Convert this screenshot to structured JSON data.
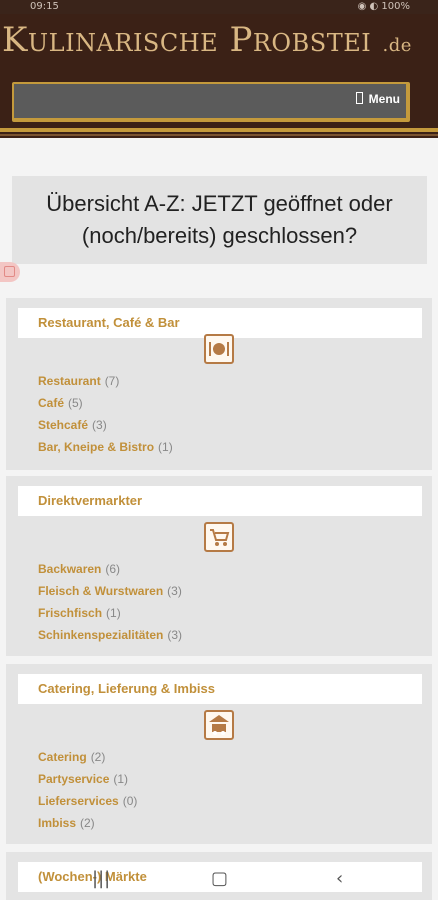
{
  "status": {
    "time": "09:15",
    "icons": "◉ ◐ 100%"
  },
  "site": {
    "logo_main": "Kulinarische Probstei",
    "logo_tld": ".de"
  },
  "nav": {
    "menu_label": "Menu"
  },
  "page": {
    "title": "Übersicht A-Z: JETZT geöffnet oder (noch/bereits) geschlossen?"
  },
  "categories": [
    {
      "title": "Restaurant, Café & Bar",
      "icon": "dining-plate-icon",
      "items": [
        {
          "label": "Restaurant",
          "count": "(7)"
        },
        {
          "label": "Café",
          "count": "(5)"
        },
        {
          "label": "Stehcafé",
          "count": "(3)"
        },
        {
          "label": "Bar, Kneipe & Bistro",
          "count": "(1)"
        }
      ]
    },
    {
      "title": "Direktvermarkter",
      "icon": "shopping-cart-icon",
      "items": [
        {
          "label": "Backwaren",
          "count": "(6)"
        },
        {
          "label": "Fleisch & Wurstwaren",
          "count": "(3)"
        },
        {
          "label": "Frischfisch",
          "count": "(1)"
        },
        {
          "label": "Schinkenspezialitäten",
          "count": "(3)"
        }
      ]
    },
    {
      "title": "Catering, Lieferung & Imbiss",
      "icon": "delivery-van-icon",
      "items": [
        {
          "label": "Catering",
          "count": "(2)"
        },
        {
          "label": "Partyservice",
          "count": "(1)"
        },
        {
          "label": "Lieferservices",
          "count": "(0)"
        },
        {
          "label": "Imbiss",
          "count": "(2)"
        }
      ]
    },
    {
      "title": "(Wochen-) Märkte",
      "items": []
    }
  ],
  "colors": {
    "brand_dark": "#3b2116",
    "gold": "#c49a3c",
    "link": "#c1903a"
  }
}
